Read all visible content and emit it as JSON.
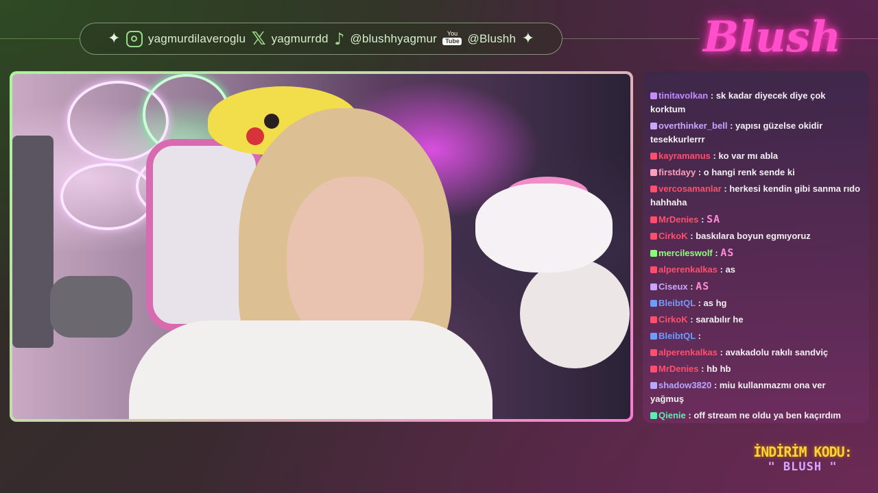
{
  "socials": {
    "instagram": "yagmurdilaveroglu",
    "x": "yagmurrdd",
    "tiktok": "@blushhyagmur",
    "youtube": "@Blushh",
    "youtube_icon_top": "You",
    "youtube_icon_bottom": "Tube"
  },
  "brand": {
    "logo_text": "Blush",
    "accent": "#ff4fcb",
    "frame_green": "#a9f59a",
    "frame_pink": "#ff78d2"
  },
  "chat": {
    "messages": [
      {
        "user": "tinitavolkan",
        "color": "#c48bff",
        "text": ": sk kadar diyecek diye çok korktum"
      },
      {
        "user": "overthinker_bell",
        "color": "#c8a6ff",
        "text": ": yapısı güzelse okidir tesekkurlerrr"
      },
      {
        "user": "kayramanus",
        "color": "#ff4f6d",
        "text": ": ko var mı abla"
      },
      {
        "user": "firstdayy",
        "color": "#ff9fbd",
        "text": ": o hangi renk sende ki"
      },
      {
        "user": "vercosamanlar",
        "color": "#ff4f6d",
        "text": ": herkesi kendin gibi sanma rıdo hahhaha"
      },
      {
        "user": "MrDenies",
        "color": "#ff4f6d",
        "text": ":",
        "pixel": "SA"
      },
      {
        "user": "CirkoK",
        "color": "#ff4f6d",
        "text": ": baskılara boyun egmıyoruz"
      },
      {
        "user": "mercileswolf",
        "color": "#8cff7a",
        "text": ":",
        "pixel": "AS"
      },
      {
        "user": "alperenkalkas",
        "color": "#ff4f6d",
        "text": ": as"
      },
      {
        "user": "Ciseux",
        "color": "#c8a6ff",
        "text": ":",
        "pixel": "AS"
      },
      {
        "user": "BleibtQL",
        "color": "#6f9bff",
        "text": ": as hg"
      },
      {
        "user": "CirkoK",
        "color": "#ff4f6d",
        "text": ": sarabılır he"
      },
      {
        "user": "BleibtQL",
        "color": "#6f9bff",
        "text": ":"
      },
      {
        "user": "alperenkalkas",
        "color": "#ff4f6d",
        "text": ": avakadolu rakılı sandviç"
      },
      {
        "user": "MrDenies",
        "color": "#ff4f6d",
        "text": ": hb hb"
      },
      {
        "user": "shadow3820",
        "color": "#b9a6ff",
        "text": ": miu kullanmazmı ona ver yağmuş"
      },
      {
        "user": "Qienie",
        "color": "#5cf0b0",
        "text": ": off stream ne oldu ya ben kaçırdım adsfjasd"
      }
    ]
  },
  "promo": {
    "line1": "İNDİRİM KODU:",
    "line2": "\" BLUSH \""
  }
}
